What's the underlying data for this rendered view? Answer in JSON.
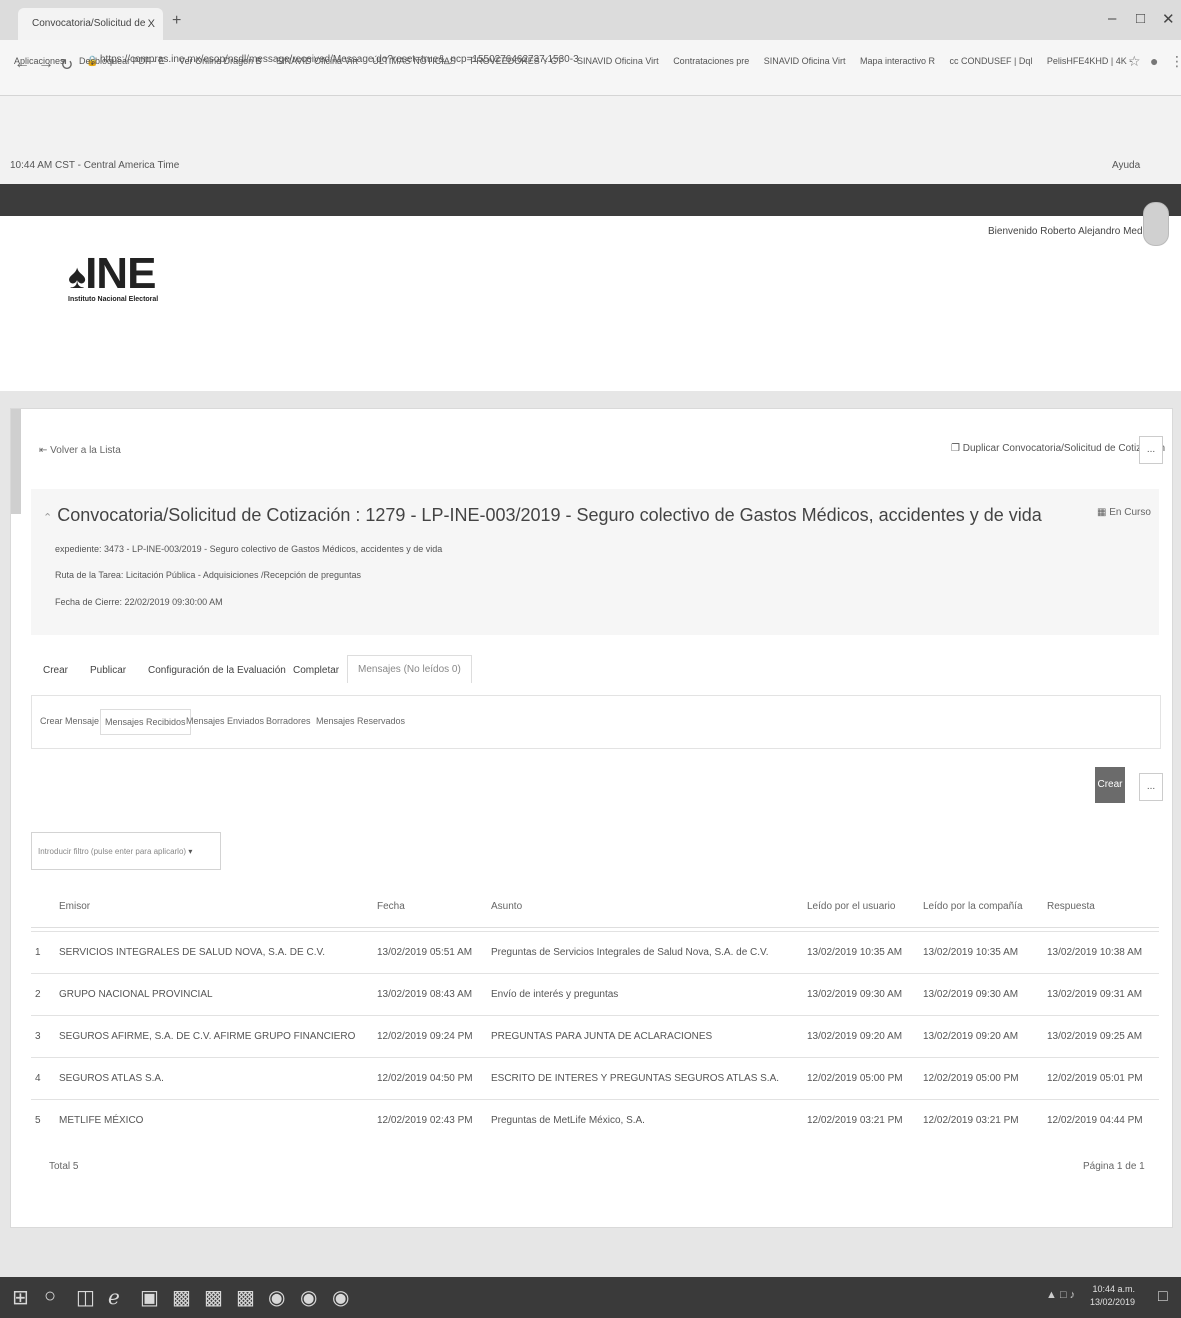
{
  "browser": {
    "tab_title": "Convocatoria/Solicitud de Cotiz",
    "tab_close": "X",
    "new_tab": "+",
    "url": "https://compras.ine.mx/esop/nsdl/message/received/Message.do?reset=true&_ncp=1550276462737.1530-3",
    "bookmarks": [
      "Aplicaciones",
      "Desbloquear PDF - E",
      "Ver Online Dragon B",
      "SINAVID Oficina Virt",
      "ÚLTIMAS NOTICIAS",
      "PROVEEDORES Y CT",
      "SINAVID Oficina Virt",
      "Contrataciones pre",
      "SINAVID Oficina Virt",
      "Mapa interactivo R",
      "cc CONDUSEF | Dql",
      "PelisHFE4KHD | 4K -"
    ]
  },
  "app": {
    "time": "10:44 AM CST - Central America Time",
    "help": "Ayuda",
    "welcome": "Bienvenido Roberto Alejandro Medina",
    "logo_text": "INE",
    "logo_sub": "Instituto Nacional Electoral"
  },
  "panel": {
    "back": "Volver a la Lista",
    "duplicate": "Duplicar Convocatoria/Solicitud de Cotización",
    "more": "...",
    "title": "Convocatoria/Solicitud de Cotización : 1279 - LP-INE-003/2019 - Seguro colectivo de Gastos Médicos, accidentes y de vida",
    "status": "En Curso",
    "expediente": "expediente: 3473 - LP-INE-003/2019 - Seguro colectivo de Gastos Médicos, accidentes y de vida",
    "ruta": "Ruta de la Tarea: Licitación Pública - Adquisiciones /Recepción de preguntas",
    "cierre": "Fecha de Cierre: 22/02/2019 09:30:00 AM",
    "tabs": [
      "Crear",
      "Publicar",
      "Configuración de la Evaluación",
      "Completar",
      "Mensajes (No leídos 0)"
    ],
    "subtabs": [
      "Crear Mensaje",
      "Mensajes Recibidos",
      "Mensajes Enviados",
      "Borradores",
      "Mensajes Reservados"
    ],
    "create_button": "Crear",
    "filter_placeholder": "Introducir filtro (pulse enter para aplicarlo)"
  },
  "table": {
    "headers": [
      "Emisor",
      "Fecha",
      "Asunto",
      "Leído por el usuario",
      "Leído por la compañía",
      "Respuesta"
    ],
    "rows": [
      [
        "1",
        "SERVICIOS INTEGRALES DE SALUD NOVA, S.A. DE C.V.",
        "13/02/2019 05:51 AM",
        "Preguntas de Servicios Integrales de Salud Nova, S.A. de C.V.",
        "13/02/2019 10:35 AM",
        "13/02/2019 10:35 AM",
        "13/02/2019 10:38 AM"
      ],
      [
        "2",
        "GRUPO NACIONAL PROVINCIAL",
        "13/02/2019 08:43 AM",
        "Envío de interés y preguntas",
        "13/02/2019 09:30 AM",
        "13/02/2019 09:30 AM",
        "13/02/2019 09:31 AM"
      ],
      [
        "3",
        "SEGUROS AFIRME, S.A. DE C.V. AFIRME GRUPO FINANCIERO",
        "12/02/2019 09:24 PM",
        "PREGUNTAS PARA JUNTA DE ACLARACIONES",
        "13/02/2019 09:20 AM",
        "13/02/2019 09:20 AM",
        "13/02/2019 09:25 AM"
      ],
      [
        "4",
        "SEGUROS ATLAS S.A.",
        "12/02/2019 04:50 PM",
        "ESCRITO DE INTERES Y PREGUNTAS SEGUROS ATLAS S.A.",
        "12/02/2019 05:00 PM",
        "12/02/2019 05:00 PM",
        "12/02/2019 05:01 PM"
      ],
      [
        "5",
        "METLIFE MÉXICO",
        "12/02/2019 02:43 PM",
        "Preguntas de MetLife México, S.A.",
        "12/02/2019 03:21 PM",
        "12/02/2019 03:21 PM",
        "12/02/2019 04:44 PM"
      ]
    ],
    "total": "Total 5",
    "pagination": "Página 1 de 1"
  },
  "taskbar": {
    "time": "10:44 a.m.",
    "date": "13/02/2019"
  }
}
